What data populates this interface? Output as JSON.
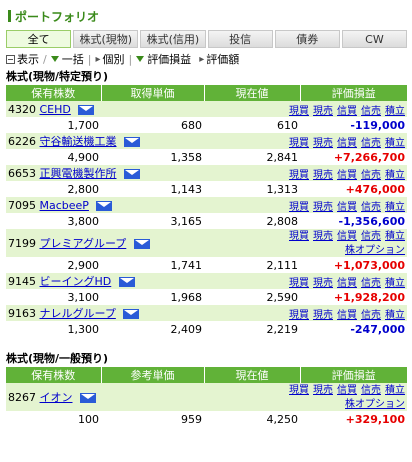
{
  "page_title": "ポートフォリオ",
  "tabs": [
    {
      "label": "全て",
      "active": true
    },
    {
      "label": "株式(現物)",
      "active": false
    },
    {
      "label": "株式(信用)",
      "active": false
    },
    {
      "label": "投信",
      "active": false
    },
    {
      "label": "債券",
      "active": false
    },
    {
      "label": "CW",
      "active": false
    }
  ],
  "toolbar": {
    "display": "表示",
    "bulk": "一括",
    "individual": "個別",
    "valuation_pl": "評価損益",
    "valuation_amount": "評価額"
  },
  "section1": {
    "title": "株式(現物/特定預り)",
    "headers": [
      "保有株数",
      "取得単価",
      "現在値",
      "評価損益"
    ],
    "rows": [
      {
        "code": "4320",
        "name": "CEHD",
        "shares": "1,700",
        "unit_price": "680",
        "current": "610",
        "pl": "-119,000",
        "pl_sign": "neg",
        "actions": [
          "現買",
          "現売",
          "信買",
          "信売",
          "積立"
        ]
      },
      {
        "code": "6226",
        "name": "守谷輸送機工業",
        "shares": "4,900",
        "unit_price": "1,358",
        "current": "2,841",
        "pl": "+7,266,700",
        "pl_sign": "pos",
        "actions": [
          "現買",
          "現売",
          "信買",
          "信売",
          "積立"
        ]
      },
      {
        "code": "6653",
        "name": "正興電機製作所",
        "shares": "2,800",
        "unit_price": "1,143",
        "current": "1,313",
        "pl": "+476,000",
        "pl_sign": "pos",
        "actions": [
          "現買",
          "現売",
          "信買",
          "信売",
          "積立"
        ]
      },
      {
        "code": "7095",
        "name": "MacbeeP",
        "shares": "3,800",
        "unit_price": "3,165",
        "current": "2,808",
        "pl": "-1,356,600",
        "pl_sign": "neg",
        "actions": [
          "現買",
          "現売",
          "信買",
          "信売",
          "積立"
        ]
      },
      {
        "code": "7199",
        "name": "プレミアグループ",
        "shares": "2,900",
        "unit_price": "1,741",
        "current": "2,111",
        "pl": "+1,073,000",
        "pl_sign": "pos",
        "actions": [
          "現買",
          "現売",
          "信買",
          "信売",
          "積立"
        ],
        "extra": "株オプション"
      },
      {
        "code": "9145",
        "name": "ビーイングHD",
        "shares": "3,100",
        "unit_price": "1,968",
        "current": "2,590",
        "pl": "+1,928,200",
        "pl_sign": "pos",
        "actions": [
          "現買",
          "現売",
          "信買",
          "信売",
          "積立"
        ]
      },
      {
        "code": "9163",
        "name": "ナレルグループ",
        "shares": "1,300",
        "unit_price": "2,409",
        "current": "2,219",
        "pl": "-247,000",
        "pl_sign": "neg",
        "actions": [
          "現買",
          "現売",
          "信買",
          "信売",
          "積立"
        ]
      }
    ]
  },
  "section2": {
    "title": "株式(現物/一般預り)",
    "headers": [
      "保有株数",
      "参考単価",
      "現在値",
      "評価損益"
    ],
    "rows": [
      {
        "code": "8267",
        "name": "イオン",
        "shares": "100",
        "unit_price": "959",
        "current": "4,250",
        "pl": "+329,100",
        "pl_sign": "pos",
        "actions": [
          "現買",
          "現売",
          "信買",
          "信売",
          "積立"
        ],
        "extra": "株オプション"
      }
    ]
  },
  "colors": {
    "accent": "#3a8a1a",
    "header_bg": "#61b238",
    "row_bg": "#e4f4d0",
    "positive": "#e60000",
    "negative": "#0000cc"
  }
}
